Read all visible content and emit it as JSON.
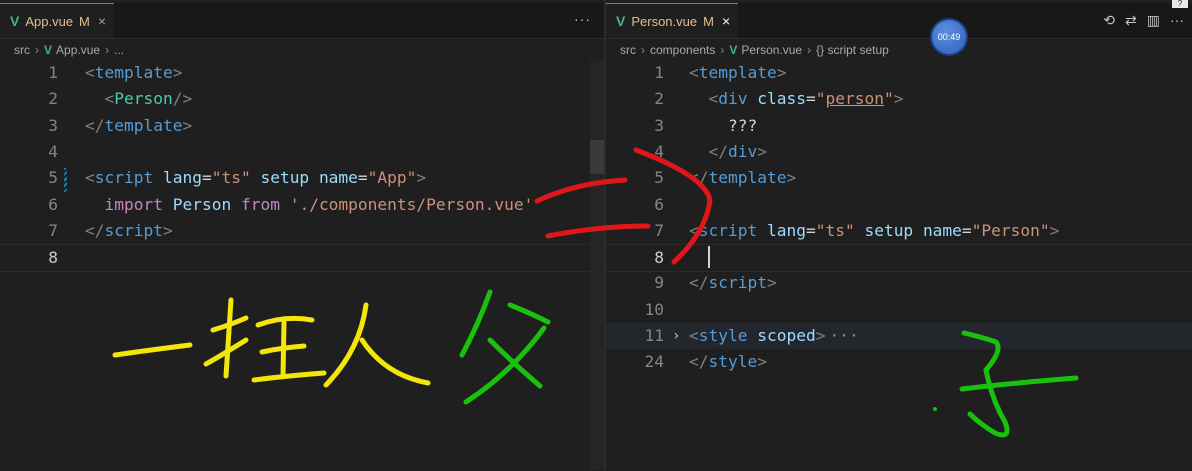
{
  "left": {
    "tab": {
      "filename": "App.vue",
      "status": "M",
      "close": "×"
    },
    "more": "···",
    "breadcrumb": [
      "src",
      "App.vue",
      "..."
    ],
    "lines": [
      {
        "n": "1",
        "tokens": [
          [
            "<",
            "bracket"
          ],
          [
            "template",
            "tag"
          ],
          [
            ">",
            "bracket"
          ]
        ]
      },
      {
        "n": "2",
        "tokens": [
          [
            "  ",
            "plain"
          ],
          [
            "<",
            "bracket"
          ],
          [
            "Person",
            "comp"
          ],
          [
            "/>",
            "bracket"
          ]
        ]
      },
      {
        "n": "3",
        "tokens": [
          [
            "</",
            "bracket"
          ],
          [
            "template",
            "tag"
          ],
          [
            ">",
            "bracket"
          ]
        ]
      },
      {
        "n": "4",
        "tokens": []
      },
      {
        "n": "5",
        "tokens": [
          [
            "<",
            "bracket"
          ],
          [
            "script",
            "tag"
          ],
          [
            " ",
            "plain"
          ],
          [
            "lang",
            "attr"
          ],
          [
            "=",
            "plain"
          ],
          [
            "\"ts\"",
            "str"
          ],
          [
            " ",
            "plain"
          ],
          [
            "setup",
            "attr"
          ],
          [
            " ",
            "plain"
          ],
          [
            "name",
            "attr"
          ],
          [
            "=",
            "plain"
          ],
          [
            "\"App\"",
            "str"
          ],
          [
            ">",
            "bracket"
          ]
        ]
      },
      {
        "n": "6",
        "tokens": [
          [
            "  ",
            "plain"
          ],
          [
            "import",
            "kw"
          ],
          [
            " ",
            "plain"
          ],
          [
            "Person",
            "id"
          ],
          [
            " ",
            "plain"
          ],
          [
            "from",
            "kw"
          ],
          [
            " ",
            "plain"
          ],
          [
            "'./components/Person.vue'",
            "str"
          ]
        ]
      },
      {
        "n": "7",
        "tokens": [
          [
            "</",
            "bracket"
          ],
          [
            "script",
            "tag"
          ],
          [
            ">",
            "bracket"
          ]
        ]
      },
      {
        "n": "8",
        "tokens": []
      }
    ]
  },
  "right": {
    "tab": {
      "filename": "Person.vue",
      "status": "M",
      "close": "×"
    },
    "breadcrumb": [
      "src",
      "components",
      "Person.vue",
      "{} script setup"
    ],
    "timer": "00:49",
    "actions": [
      "history-icon",
      "compare-icon",
      "split-icon",
      "more-icon"
    ],
    "action_glyphs": [
      "⟲",
      "⇄",
      "▥",
      "···"
    ],
    "lines": [
      {
        "n": "1",
        "tokens": [
          [
            "<",
            "bracket"
          ],
          [
            "template",
            "tag"
          ],
          [
            ">",
            "bracket"
          ]
        ]
      },
      {
        "n": "2",
        "tokens": [
          [
            "  ",
            "plain"
          ],
          [
            "<",
            "bracket"
          ],
          [
            "div",
            "tag"
          ],
          [
            " ",
            "plain"
          ],
          [
            "class",
            "attr"
          ],
          [
            "=",
            "plain"
          ],
          [
            "\"",
            "str"
          ],
          [
            "person",
            "strU"
          ],
          [
            "\"",
            "str"
          ],
          [
            ">",
            "bracket"
          ]
        ]
      },
      {
        "n": "3",
        "tokens": [
          [
            "    ???",
            "plain"
          ]
        ]
      },
      {
        "n": "4",
        "tokens": [
          [
            "  ",
            "plain"
          ],
          [
            "</",
            "bracket"
          ],
          [
            "div",
            "tag"
          ],
          [
            ">",
            "bracket"
          ]
        ]
      },
      {
        "n": "5",
        "tokens": [
          [
            "</",
            "bracket"
          ],
          [
            "template",
            "tag"
          ],
          [
            ">",
            "bracket"
          ]
        ]
      },
      {
        "n": "6",
        "tokens": []
      },
      {
        "n": "7",
        "tokens": [
          [
            "<",
            "bracket"
          ],
          [
            "script",
            "tag"
          ],
          [
            " ",
            "plain"
          ],
          [
            "lang",
            "attr"
          ],
          [
            "=",
            "plain"
          ],
          [
            "\"ts\"",
            "str"
          ],
          [
            " ",
            "plain"
          ],
          [
            "setup",
            "attr"
          ],
          [
            " ",
            "plain"
          ],
          [
            "name",
            "attr"
          ],
          [
            "=",
            "plain"
          ],
          [
            "\"Person\"",
            "str"
          ],
          [
            ">",
            "bracket"
          ]
        ]
      },
      {
        "n": "8",
        "tokens": []
      },
      {
        "n": "9",
        "tokens": [
          [
            "</",
            "bracket"
          ],
          [
            "script",
            "tag"
          ],
          [
            ">",
            "bracket"
          ]
        ]
      },
      {
        "n": "10",
        "tokens": []
      },
      {
        "n": "11",
        "tokens": [
          [
            "<",
            "bracket"
          ],
          [
            "style",
            "tag"
          ],
          [
            " ",
            "plain"
          ],
          [
            "scoped",
            "attr"
          ],
          [
            ">",
            "bracket"
          ]
        ],
        "folded": true
      },
      {
        "n": "24",
        "tokens": [
          [
            "</",
            "bracket"
          ],
          [
            "style",
            "tag"
          ],
          [
            ">",
            "bracket"
          ]
        ]
      }
    ]
  },
  "colors": {
    "vue_green": "#41b883",
    "modified": "#e2c08d",
    "pen_yellow": "#f5e60a",
    "pen_green": "#19c10e",
    "pen_red": "#e0171a"
  }
}
